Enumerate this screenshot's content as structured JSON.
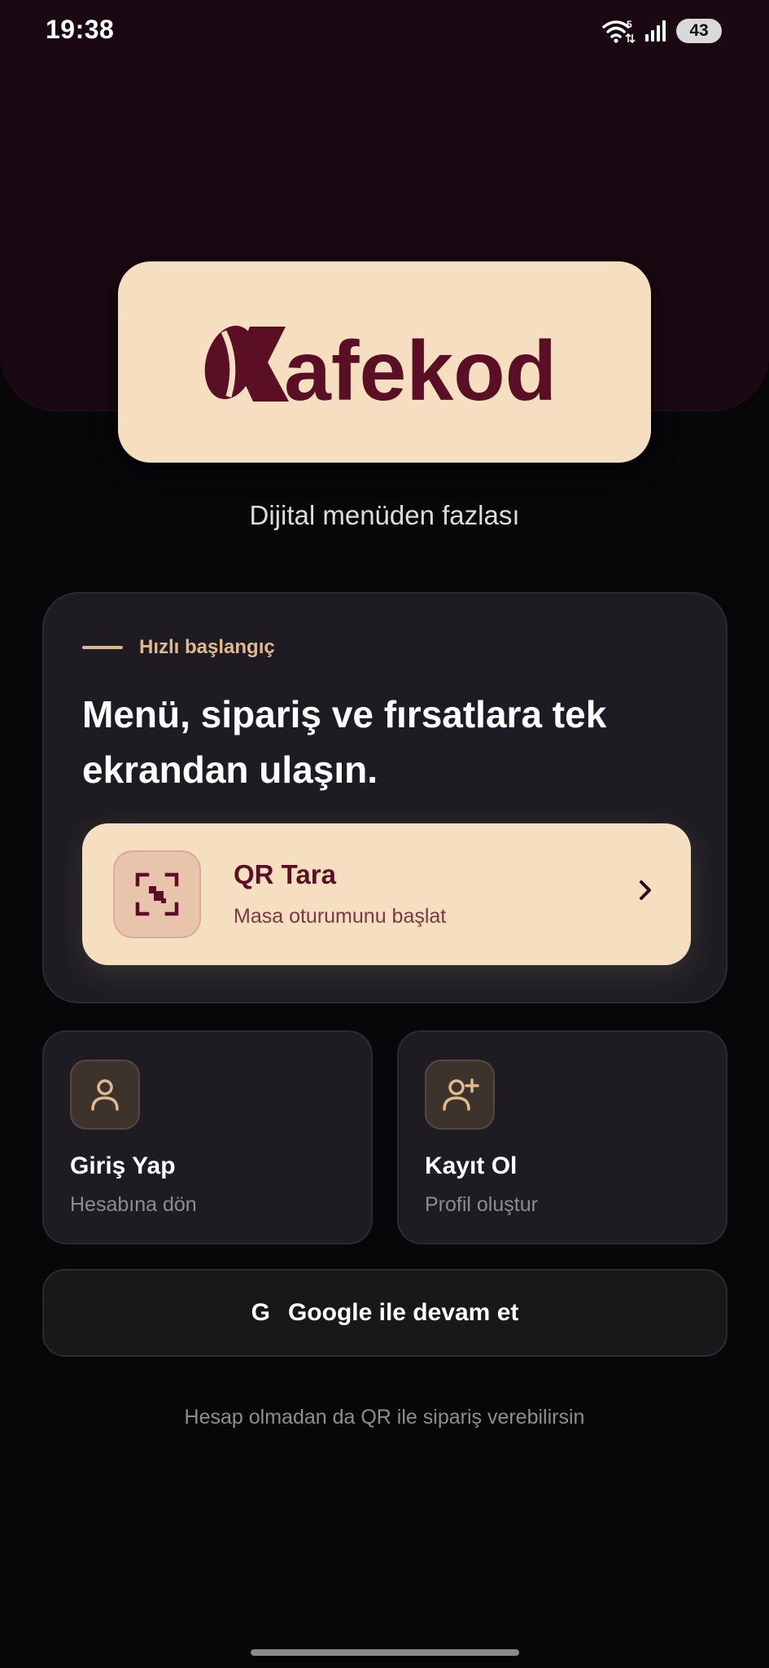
{
  "status_bar": {
    "time": "19:38",
    "wifi_badge": "5",
    "battery": "43"
  },
  "brand": {
    "logo_text": "afekod",
    "logo_initial": "K",
    "tagline": "Dijital menüden fazlası",
    "colors": {
      "brand": "#5a0f25",
      "cream": "#f6dfc0",
      "header_bg": "#1a0912",
      "accent": "#e0b789"
    }
  },
  "quick_start": {
    "eyebrow": "Hızlı başlangıç",
    "title": "Menü, sipariş ve fırsatlara tek ekrandan ulaşın.",
    "qr_button": {
      "icon": "qr-scan-icon",
      "title": "QR Tara",
      "subtitle": "Masa oturumunu başlat",
      "chevron": "chevron-right-icon"
    }
  },
  "actions": [
    {
      "icon": "user-icon",
      "title": "Giriş Yap",
      "subtitle": "Hesabına dön"
    },
    {
      "icon": "user-plus-icon",
      "title": "Kayıt Ol",
      "subtitle": "Profil oluştur"
    }
  ],
  "google": {
    "icon_letter": "G",
    "label": "Google ile devam et"
  },
  "footer_note": "Hesap olmadan da QR ile sipariş verebilirsin"
}
